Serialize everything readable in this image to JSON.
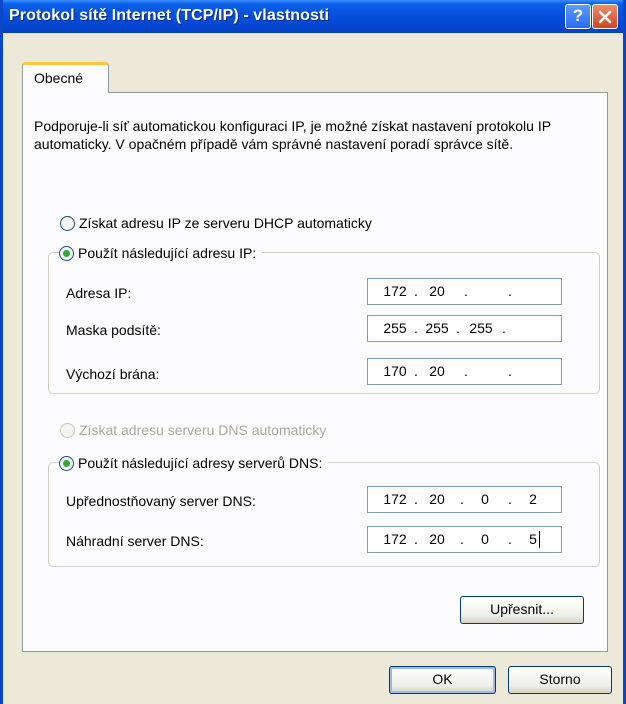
{
  "window": {
    "title": "Protokol sítě Internet (TCP/IP) - vlastnosti",
    "help_label": "?"
  },
  "tabs": [
    {
      "label": "Obecné",
      "selected": true
    }
  ],
  "description": "Podporuje-li síť automatickou konfiguraci IP, je možné získat nastavení protokolu IP automaticky. V opačném případě vám správné nastavení poradí správce sítě.",
  "ip_section": {
    "radio_auto": {
      "label": "Získat adresu IP ze serveru DHCP automaticky",
      "selected": false,
      "enabled": true
    },
    "radio_manual": {
      "label": "Použít následující adresu IP:",
      "selected": true,
      "enabled": true
    },
    "fields": [
      {
        "label": "Adresa IP:",
        "octets": [
          "172",
          "20",
          "",
          ""
        ]
      },
      {
        "label": "Maska podsítě:",
        "octets": [
          "255",
          "255",
          "255",
          ""
        ]
      },
      {
        "label": "Výchozí brána:",
        "octets": [
          "170",
          "20",
          "",
          ""
        ]
      }
    ]
  },
  "dns_section": {
    "radio_auto": {
      "label": "Získat adresu serveru DNS automaticky",
      "selected": false,
      "enabled": false
    },
    "radio_manual": {
      "label": "Použít následující adresy serverů DNS:",
      "selected": true,
      "enabled": true
    },
    "fields": [
      {
        "label": "Upřednostňovaný server DNS:",
        "octets": [
          "172",
          "20",
          "0",
          "2"
        ]
      },
      {
        "label": "Náhradní server DNS:",
        "octets": [
          "172",
          "20",
          "0",
          "5"
        ]
      }
    ]
  },
  "buttons": {
    "advanced": "Upřesnit...",
    "ok": "OK",
    "cancel": "Storno"
  },
  "colors": {
    "titlebar": "#0653de",
    "window_border": "#0a47c8",
    "dialog_bg": "#ece9d8",
    "panel_bg": "#fcfcfe",
    "tab_highlight": "#ffc83c",
    "radio_dot": "#2fa83a",
    "disabled_text": "#aca899"
  }
}
